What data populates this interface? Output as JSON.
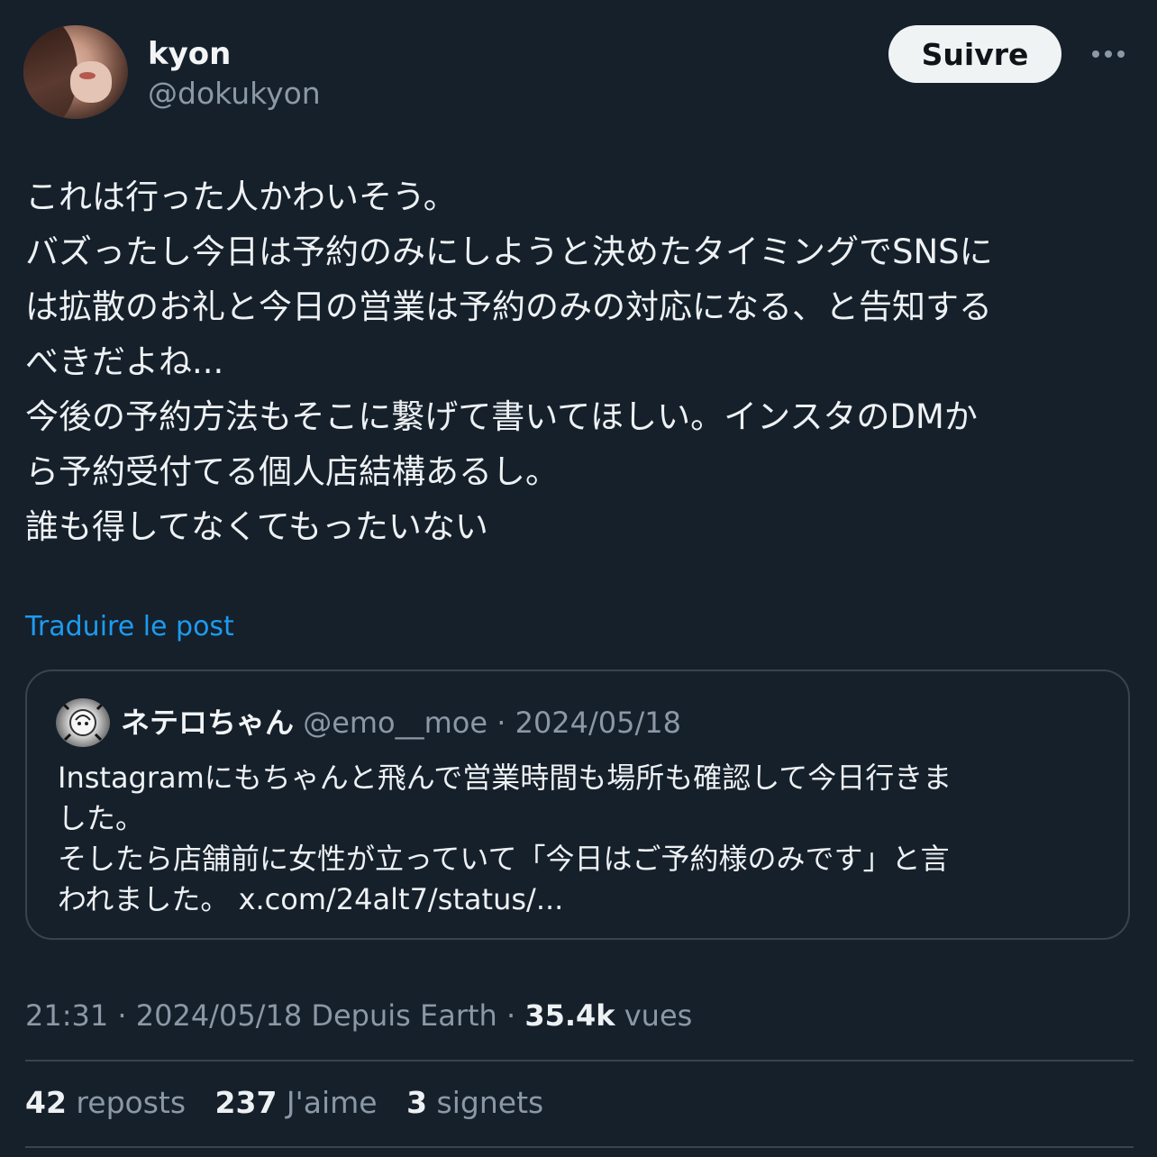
{
  "author": {
    "display_name": "kyon",
    "handle": "@dokukyon"
  },
  "follow_button": {
    "label": "Suivre"
  },
  "more_button": {
    "icon": "more-horizontal-icon"
  },
  "post": {
    "lines": [
      "これは行った人かわいそう。",
      "バズったし今日は予約のみにしようと決めたタイミングでSNSに",
      "は拡散のお礼と今日の営業は予約のみの対応になる、と告知する",
      "べきだよね...",
      "今後の予約方法もそこに繋げて書いてほしい。インスタのDMか",
      "ら予約受付てる個人店結構あるし。",
      "誰も得してなくてもったいない"
    ],
    "translate_label": "Traduire le post"
  },
  "quote": {
    "name": "ネテロちゃん",
    "meta": "@emo__moe · 2024/05/18",
    "lines": [
      "Instagramにもちゃんと飛んで営業時間も場所も確認して今日行きま",
      "した。",
      "そしたら店舗前に女性が立っていて「今日はご予約様のみです」と言",
      "われました。 x.com/24alt7/status/..."
    ]
  },
  "meta": {
    "time_date": "21:31 · 2024/05/18 Depuis Earth · ",
    "views_count": "35.4k",
    "views_label": " vues"
  },
  "stats": {
    "reposts_count": "42",
    "reposts_label": " reposts",
    "likes_count": "237",
    "likes_label": " J'aime",
    "bookmarks_count": "3",
    "bookmarks_label": " signets"
  },
  "colors": {
    "background": "#15202b",
    "link": "#1d9bf0",
    "secondary_text": "#8b98a5",
    "border": "#38444d"
  }
}
